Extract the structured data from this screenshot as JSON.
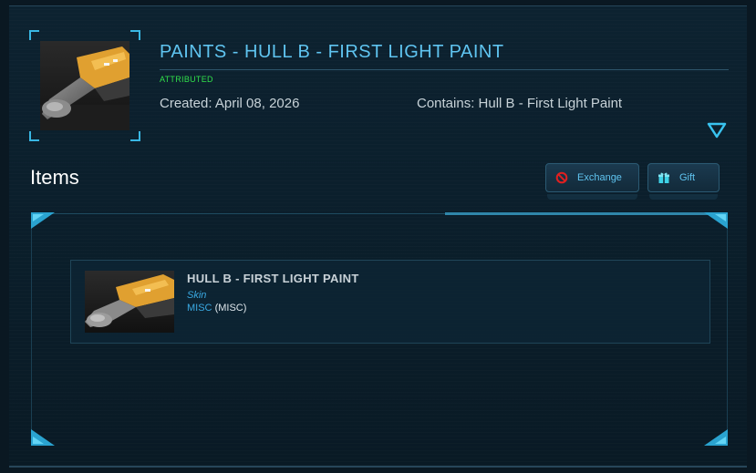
{
  "header": {
    "title": "PAINTS - HULL B - FIRST LIGHT PAINT",
    "status": "ATTRIBUTED",
    "created": "Created: April 08, 2026",
    "contains": "Contains: Hull B - First Light Paint"
  },
  "items_section": {
    "heading": "Items",
    "exchange_label": "Exchange",
    "gift_label": "Gift"
  },
  "item": {
    "name": "HULL B - FIRST LIGHT PAINT",
    "type": "Skin",
    "category": "MISC",
    "category_detail": "(MISC)"
  },
  "colors": {
    "accent": "#5fc4f0",
    "status_green": "#31e04a",
    "exchange_icon": "#e02020",
    "gift_icon": "#3fd3e8"
  },
  "icons": {
    "expand": "triangle-down-icon",
    "exchange": "no-entry-icon",
    "gift": "gift-icon"
  }
}
